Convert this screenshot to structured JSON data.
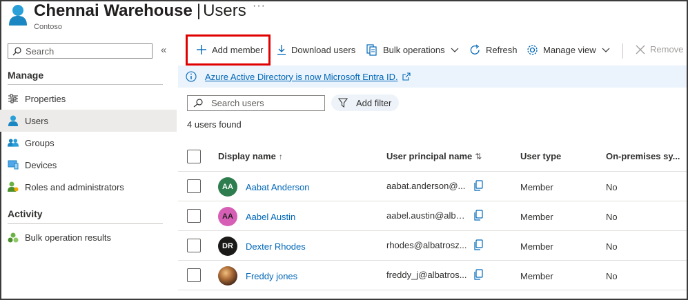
{
  "header": {
    "title_app": "Chennai Warehouse",
    "title_sep": "|",
    "title_page": "Users",
    "more": "···",
    "subtitle": "Contoso"
  },
  "sidebar": {
    "search_placeholder": "Search",
    "collapse": "«",
    "manage_label": "Manage",
    "activity_label": "Activity",
    "items": [
      {
        "label": "Properties",
        "icon": "properties-icon"
      },
      {
        "label": "Users",
        "icon": "user-icon",
        "selected": true
      },
      {
        "label": "Groups",
        "icon": "groups-icon"
      },
      {
        "label": "Devices",
        "icon": "devices-icon"
      },
      {
        "label": "Roles and administrators",
        "icon": "roles-icon"
      }
    ],
    "activity_items": [
      {
        "label": "Bulk operation results",
        "icon": "bulk-results-icon"
      }
    ]
  },
  "toolbar": {
    "add_member": "Add member",
    "download_users": "Download users",
    "bulk_operations": "Bulk operations",
    "refresh": "Refresh",
    "manage_view": "Manage view",
    "remove": "Remove"
  },
  "banner": {
    "text": "Azure Active Directory is now Microsoft Entra ID."
  },
  "filters": {
    "search_placeholder": "Search users",
    "add_filter": "Add filter",
    "found": "4 users found"
  },
  "table": {
    "columns": [
      "Display name",
      "User principal name",
      "User type",
      "On-premises sy..."
    ],
    "sort_up": "↑",
    "sort_both": "⇅",
    "rows": [
      {
        "initials": "AA",
        "name": "Aabat Anderson",
        "upn": "aabat.anderson@...",
        "type": "Member",
        "onprem": "No",
        "color": "#2e7d4f"
      },
      {
        "initials": "AA",
        "name": "Aabel Austin",
        "upn": "aabel.austin@alba...",
        "type": "Member",
        "onprem": "No",
        "color": "#d65fb5"
      },
      {
        "initials": "DR",
        "name": "Dexter Rhodes",
        "upn": "rhodes@albatrosz...",
        "type": "Member",
        "onprem": "No",
        "color": "#1b1a19"
      },
      {
        "initials": "",
        "name": "Freddy jones",
        "upn": "freddy_j@albatros...",
        "type": "Member",
        "onprem": "No",
        "color": "#6b4a2e"
      }
    ]
  },
  "colors": {
    "accent": "#0067b8",
    "highlight": "#e00000",
    "banner_bg": "#ebf3fc",
    "selected_bg": "#edebe9"
  }
}
